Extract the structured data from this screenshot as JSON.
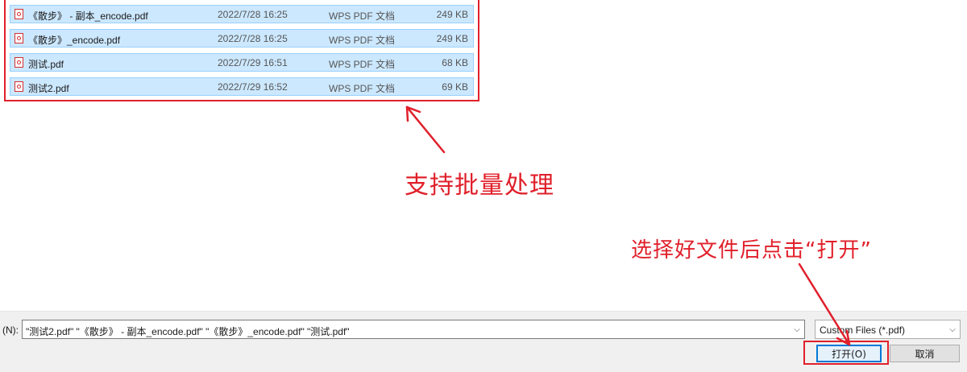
{
  "file_list": {
    "rows": [
      {
        "name": "《散步》 - 副本_encode.pdf",
        "date": "2022/7/28 16:25",
        "type": "WPS PDF 文档",
        "size": "249 KB"
      },
      {
        "name": "《散步》_encode.pdf",
        "date": "2022/7/28 16:25",
        "type": "WPS PDF 文档",
        "size": "249 KB"
      },
      {
        "name": "测试.pdf",
        "date": "2022/7/29 16:51",
        "type": "WPS PDF 文档",
        "size": "68 KB"
      },
      {
        "name": "测试2.pdf",
        "date": "2022/7/29 16:52",
        "type": "WPS PDF 文档",
        "size": "69 KB"
      }
    ],
    "file_icon": "pdf-file-icon"
  },
  "annotations": {
    "batch": "支持批量处理",
    "open_hint": "选择好文件后点击“打开”",
    "color": "#e0202b"
  },
  "bottom_bar": {
    "filename_label": "(N):",
    "filename_value": "\"测试2.pdf\" \"《散步》 - 副本_encode.pdf\" \"《散步》_encode.pdf\" \"测试.pdf\"",
    "filter_value": "Custom Files (*.pdf)",
    "open_label": "打开(O)",
    "cancel_label": "取消"
  }
}
